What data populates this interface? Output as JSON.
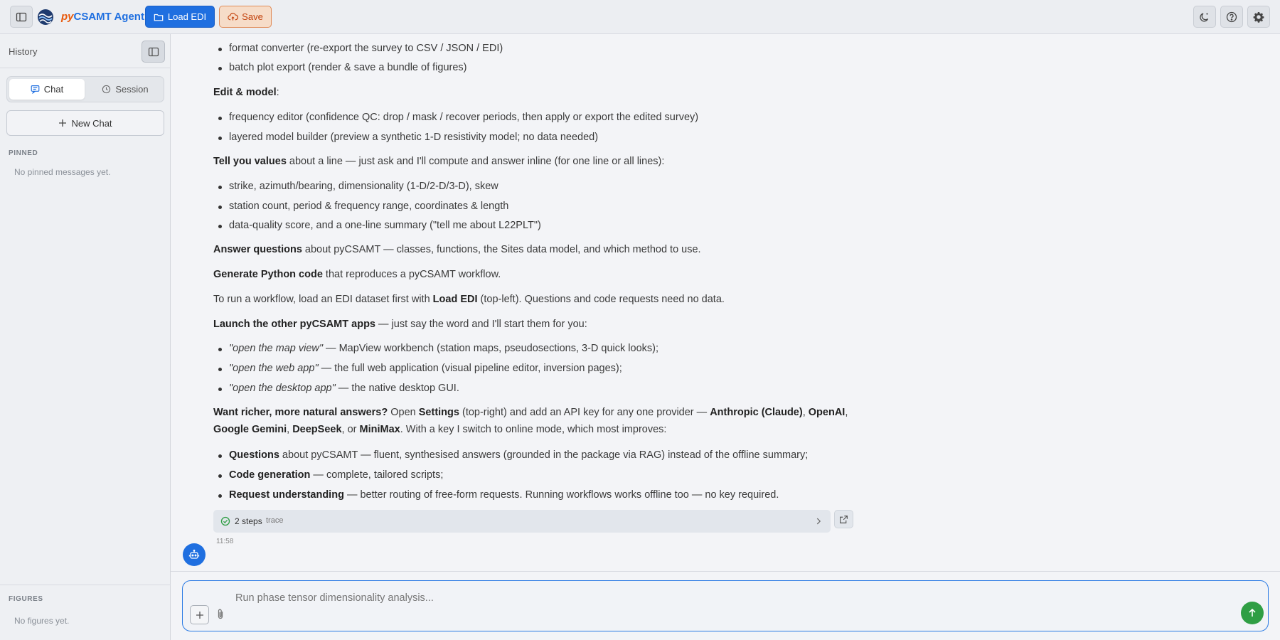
{
  "header": {
    "app_title_prefix": "py",
    "app_title_rest": "CSAMT Agent",
    "load_label": "Load EDI",
    "save_label": "Save",
    "icons": [
      "sidebar-toggle-icon",
      "moon-icon",
      "help-icon",
      "gear-icon"
    ]
  },
  "sidebar": {
    "title": "History",
    "tabs": [
      {
        "label": "Chat",
        "icon": "chat-icon",
        "active": true
      },
      {
        "label": "Session",
        "icon": "clock-icon",
        "active": false
      }
    ],
    "new_chat_label": "New Chat",
    "pinned": {
      "label": "PINNED",
      "empty": "No pinned messages yet."
    },
    "figures": {
      "label": "FIGURES",
      "empty": "No figures yet."
    }
  },
  "message": {
    "b1": "format converter (re-export the survey to CSV / JSON / EDI)",
    "b2": "batch plot export (render & save a bundle of figures)",
    "edit_title": "Edit & model",
    "edit_colon": ":",
    "b3": "frequency editor (confidence QC: drop / mask / recover periods, then apply or export the edited survey)",
    "b4": "layered model builder (preview a synthetic 1-D resistivity model; no data needed)",
    "values_bold": "Tell you values",
    "values_rest": " about a line — just ask and I'll compute and answer inline (for one line or all lines):",
    "b5": "strike, azimuth/bearing, dimensionality (1-D/2-D/3-D), skew",
    "b6": "station count, period & frequency range, coordinates & length",
    "b7": "data-quality score, and a one-line summary (\"tell me about L22PLT\")",
    "answer_bold": "Answer questions",
    "answer_rest": " about pyCSAMT — classes, functions, the Sites data model, and which method to use.",
    "gen_bold": "Generate Python code",
    "gen_rest": " that reproduces a pyCSAMT workflow.",
    "run_a": "To run a workflow, load an EDI dataset first with ",
    "run_bold": "Load EDI",
    "run_b": " (top-left). Questions and code requests need no data.",
    "launch_bold": "Launch the other pyCSAMT apps",
    "launch_rest": " — just say the word and I'll start them for you:",
    "l1_it": "\"open the map view\"",
    "l1_rest": " — MapView workbench (station maps, pseudosections, 3-D quick looks);",
    "l2_it": "\"open the web app\"",
    "l2_rest": " — the full web application (visual pipeline editor, inversion pages);",
    "l3_it": "\"open the desktop app\"",
    "l3_rest": " — the native desktop GUI.",
    "want_bold": "Want richer, more natural answers?",
    "want_a": " Open ",
    "want_settings": "Settings",
    "want_b": " (top-right) and add an API key for any one provider — ",
    "p_anthropic": "Anthropic (Claude)",
    "comma1": ", ",
    "p_openai": "OpenAI",
    "comma2": ", ",
    "p_gemini": "Google Gemini",
    "comma3": ", ",
    "p_deepseek": "DeepSeek",
    "or_text": ", or ",
    "p_minimax": "MiniMax",
    "want_c": ". With a key I switch to online mode, which most improves:",
    "q_bold": "Questions",
    "q_rest": " about pyCSAMT — fluent, synthesised answers (grounded in the package via RAG) instead of the offline summary;",
    "c_bold": "Code generation",
    "c_rest": " — complete, tailored scripts;",
    "r_bold": "Request understanding",
    "r_rest": " — better routing of free-form requests. Running workflows works offline too — no key required."
  },
  "trace": {
    "steps": "2 steps",
    "label": "trace"
  },
  "timestamp": "11:58",
  "composer": {
    "placeholder": "Run phase tensor dimensionality analysis..."
  },
  "colors": {
    "accent": "#1f6fe0",
    "save": "#c2410c",
    "send": "#2f9e44"
  }
}
